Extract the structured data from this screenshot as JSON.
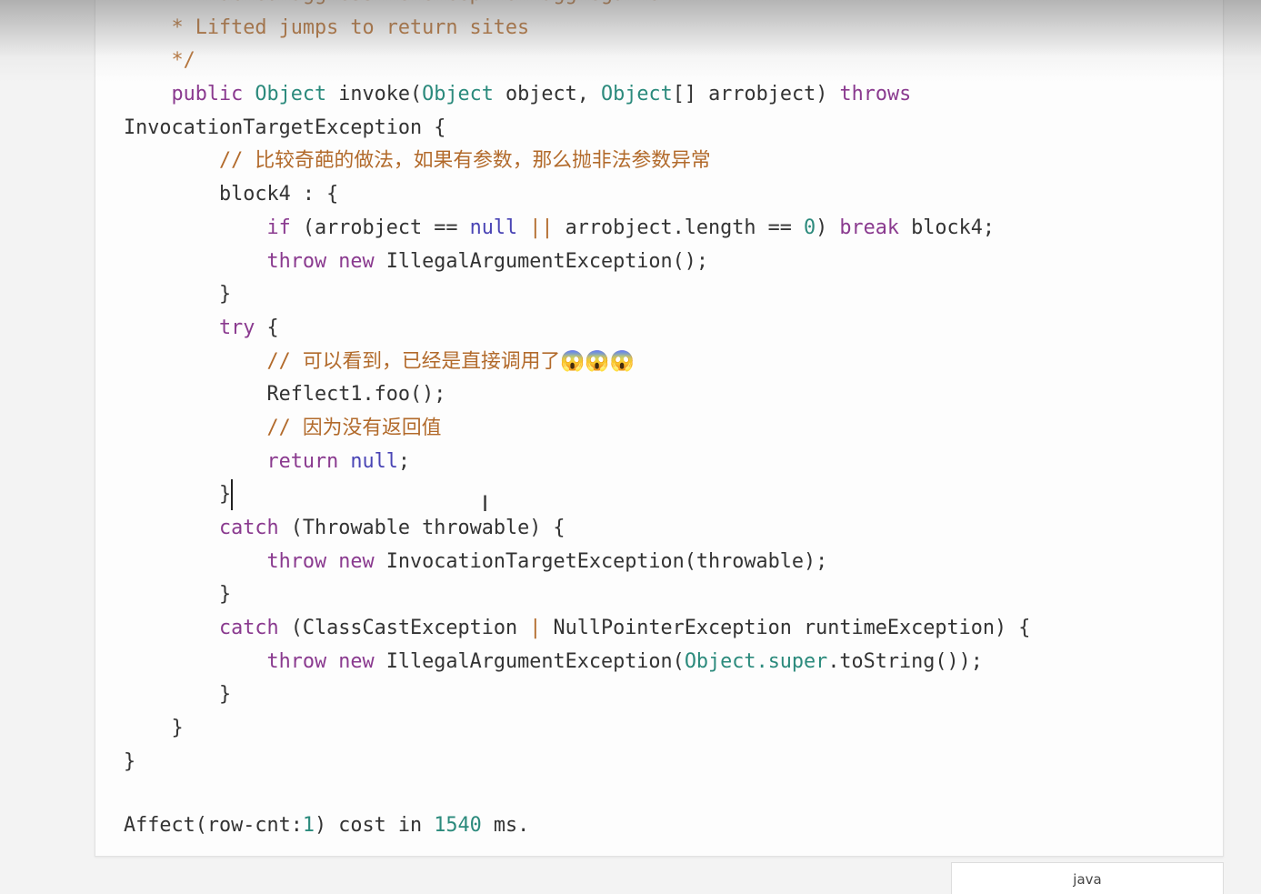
{
  "code_lines": [
    [
      [
        "c",
        "    * Enabled aggressive exception aggregation"
      ]
    ],
    [
      [
        "c",
        "    * Lifted jumps to return sites"
      ]
    ],
    [
      [
        "c",
        "    */"
      ]
    ],
    [
      [
        "",
        "    "
      ],
      [
        "k",
        "public"
      ],
      [
        "",
        " "
      ],
      [
        "t",
        "Object"
      ],
      [
        "",
        " invoke("
      ],
      [
        "t",
        "Object"
      ],
      [
        "",
        " object, "
      ],
      [
        "t",
        "Object"
      ],
      [
        "",
        "[] arrobject) "
      ],
      [
        "k",
        "throws"
      ]
    ],
    [
      [
        "",
        "InvocationTargetException {"
      ]
    ],
    [
      [
        "",
        "        "
      ],
      [
        "c",
        "// 比较奇葩的做法，如果有参数，那么抛非法参数异常"
      ]
    ],
    [
      [
        "",
        "        block4 : {"
      ]
    ],
    [
      [
        "",
        "            "
      ],
      [
        "k",
        "if"
      ],
      [
        "",
        " (arrobject == "
      ],
      [
        "n",
        "null"
      ],
      [
        "",
        " "
      ],
      [
        "op",
        "||"
      ],
      [
        "",
        " arrobject.length == "
      ],
      [
        "num",
        "0"
      ],
      [
        "",
        ") "
      ],
      [
        "k",
        "break"
      ],
      [
        "",
        " block4;"
      ]
    ],
    [
      [
        "",
        "            "
      ],
      [
        "k",
        "throw"
      ],
      [
        "",
        " "
      ],
      [
        "k",
        "new"
      ],
      [
        "",
        " IllegalArgumentException();"
      ]
    ],
    [
      [
        "",
        "        }"
      ]
    ],
    [
      [
        "",
        "        "
      ],
      [
        "k",
        "try"
      ],
      [
        "",
        " {"
      ]
    ],
    [
      [
        "",
        "            "
      ],
      [
        "c",
        "// 可以看到，已经是直接调用了😱😱😱"
      ]
    ],
    [
      [
        "",
        "            Reflect1.foo();"
      ]
    ],
    [
      [
        "",
        "            "
      ],
      [
        "c",
        "// 因为没有返回值"
      ]
    ],
    [
      [
        "",
        "            "
      ],
      [
        "k",
        "return"
      ],
      [
        "",
        " "
      ],
      [
        "n",
        "null"
      ],
      [
        "",
        ";"
      ]
    ],
    [
      [
        "",
        "        }"
      ],
      [
        "caret",
        ""
      ]
    ],
    [
      [
        "",
        "        "
      ],
      [
        "k",
        "catch"
      ],
      [
        "",
        " (Throwable throwable) {"
      ]
    ],
    [
      [
        "",
        "            "
      ],
      [
        "k",
        "throw"
      ],
      [
        "",
        " "
      ],
      [
        "k",
        "new"
      ],
      [
        "",
        " InvocationTargetException(throwable);"
      ]
    ],
    [
      [
        "",
        "        }"
      ]
    ],
    [
      [
        "",
        "        "
      ],
      [
        "k",
        "catch"
      ],
      [
        "",
        " (ClassCastException "
      ],
      [
        "op",
        "|"
      ],
      [
        "",
        " NullPointerException runtimeException) {"
      ]
    ],
    [
      [
        "",
        "            "
      ],
      [
        "k",
        "throw"
      ],
      [
        "",
        " "
      ],
      [
        "k",
        "new"
      ],
      [
        "",
        " IllegalArgumentException("
      ],
      [
        "t",
        "Object"
      ],
      [
        "t",
        "."
      ],
      [
        "t",
        "super"
      ],
      [
        "",
        ".toString());"
      ]
    ],
    [
      [
        "",
        "        }"
      ]
    ],
    [
      [
        "",
        "    }"
      ]
    ],
    [
      [
        "",
        "}"
      ]
    ]
  ],
  "status": {
    "prefix": "Affect(row-cnt:",
    "rows": "1",
    "middle": ") cost in ",
    "ms": "1540",
    "suffix": " ms."
  },
  "language_tab": "java",
  "colors": {
    "keyword": "#8a3a8f",
    "type": "#2b8a7c",
    "comment": "#b26a2b",
    "literal": "#4a45b5"
  }
}
